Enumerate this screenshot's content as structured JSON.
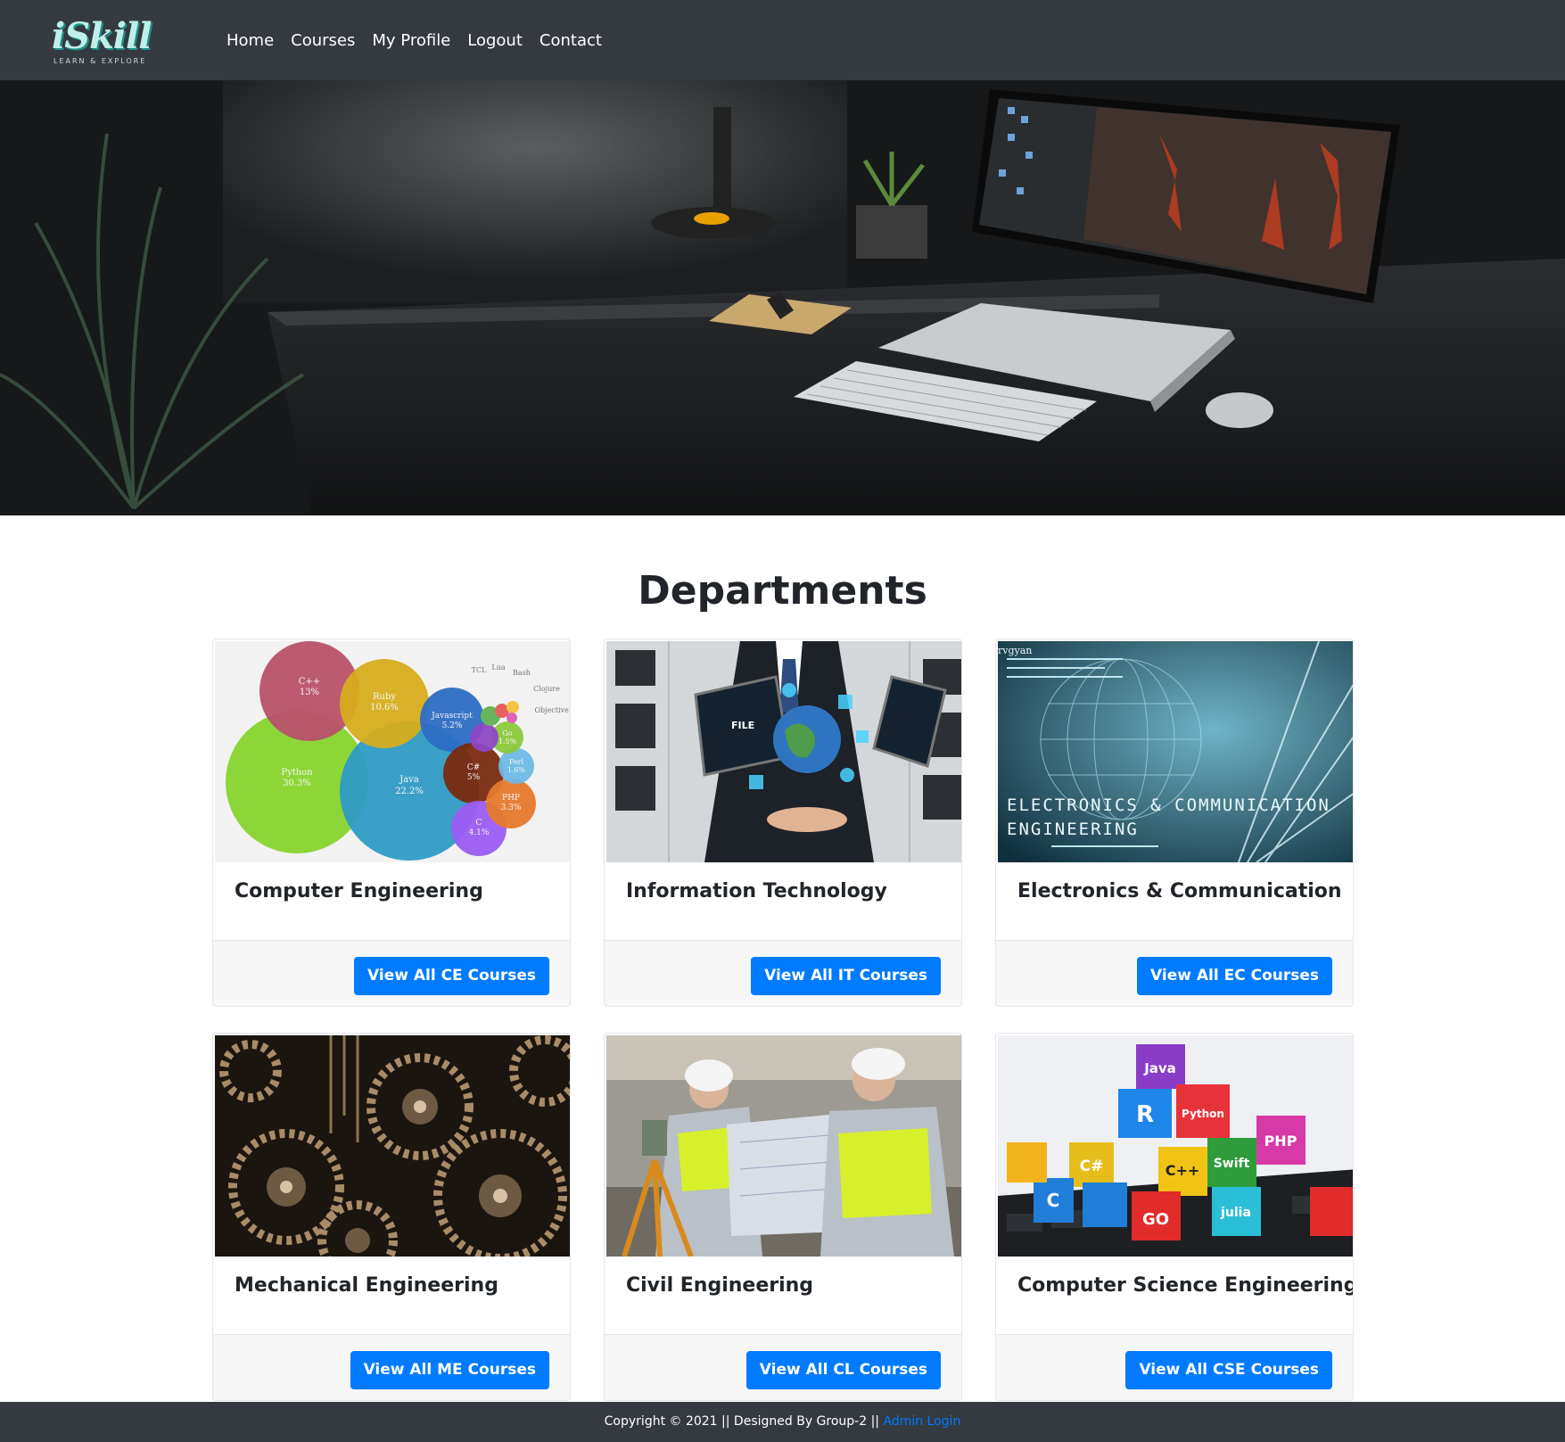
{
  "navbar": {
    "logo_text": "iSkill",
    "logo_tagline": "LEARN & EXPLORE",
    "links": [
      "Home",
      "Courses",
      "My Profile",
      "Logout",
      "Contact"
    ]
  },
  "main": {
    "title": "Departments",
    "cards": [
      {
        "title": "Computer Engineering",
        "button": "View All CE Courses"
      },
      {
        "title": "Information Technology",
        "button": "View All IT Courses"
      },
      {
        "title": "Electronics & Communication",
        "button": "View All EC Courses"
      },
      {
        "title": "Mechanical Engineering",
        "button": "View All ME Courses"
      },
      {
        "title": "Civil Engineering",
        "button": "View All CL Courses"
      },
      {
        "title": "Computer Science Engineering",
        "button": "View All CSE Courses"
      }
    ],
    "images": {
      "ce_bubbles": [
        "C++",
        "13%",
        "Ruby",
        "10.6%",
        "Javascript",
        "5.2%",
        "Python",
        "30.3%",
        "Java",
        "22.2%",
        "C#",
        "5%",
        "PHP",
        "3.3%",
        "C",
        "4.1%",
        "Perl",
        "1.6%",
        "Go",
        "1.5%",
        "TCL",
        "Lua",
        "Bash",
        "Clojure",
        "Objective C"
      ],
      "it_label": "FILE",
      "ec_banner_line1": "ELECTRONICS & COMMUNICATION",
      "ec_banner_line2": "ENGINEERING",
      "ec_brand": "rvgyan",
      "cse_cubes": [
        "Java",
        "R",
        "Python",
        "PHP",
        "C#",
        "C++",
        "Swift",
        "GO",
        "C",
        "julia"
      ]
    }
  },
  "footer": {
    "text": "Copyright © 2021 || Designed By Group-2 ||",
    "admin_link": "Admin Login"
  },
  "colors": {
    "navbar_bg": "#343a40",
    "primary_button": "#007bff",
    "card_footer_bg": "#f7f7f7"
  }
}
